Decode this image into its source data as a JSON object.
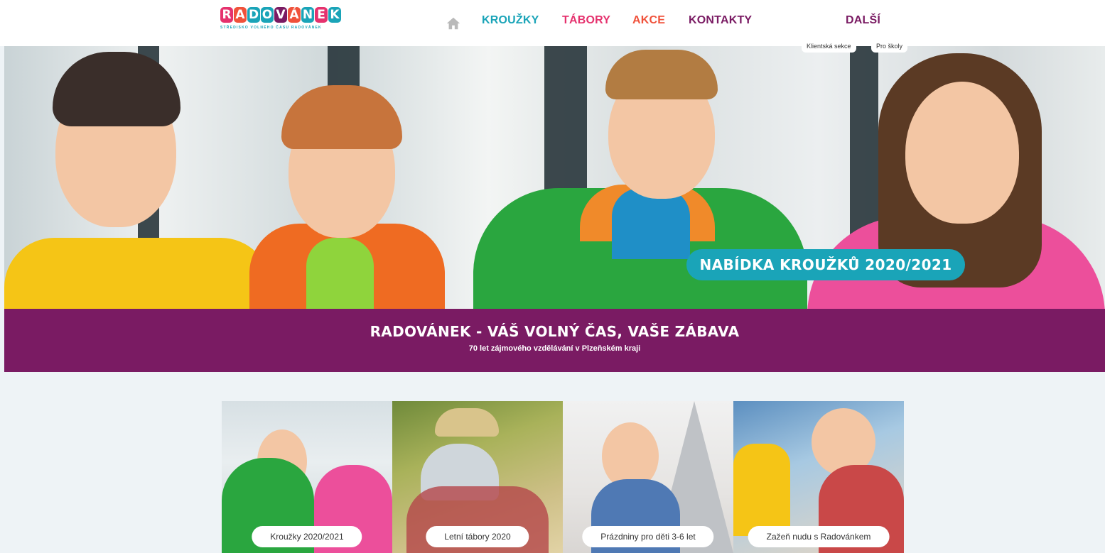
{
  "header": {
    "logo_text": "RADOVÁNEK",
    "logo_tagline": "STŘEDISKO VOLNÉHO ČASU RADOVÁNEK",
    "logo_colors": [
      "#e5326e",
      "#f0523b",
      "#1aa4b8",
      "#1aa4b8",
      "#7a1b63",
      "#f0523b",
      "#1aa4b8",
      "#e5326e",
      "#1aa4b8"
    ],
    "nav": {
      "home_icon": "home-icon",
      "krouzky": "KROUŽKY",
      "tabory": "TÁBORY",
      "akce": "AKCE",
      "kontakty": "KONTAKTY",
      "dalsi": "DALŠÍ"
    },
    "sub_links": {
      "klientska": "Klientská sekce",
      "skoly": "Pro školy"
    }
  },
  "hero": {
    "badge": "NABÍDKA KROUŽKŮ 2020/2021"
  },
  "banner": {
    "title": "RADOVÁNEK - VÁŠ VOLNÝ ČAS, VAŠE ZÁBAVA",
    "subtitle": "70 let zájmového vzdělávání v Plzeňském kraji"
  },
  "cards": [
    {
      "label": "Kroužky 2020/2021"
    },
    {
      "label": "Letní tábory 2020"
    },
    {
      "label": "Prázdniny pro děti 3-6 let"
    },
    {
      "label": "Zažeň nudu s Radovánkem"
    }
  ],
  "colors": {
    "teal": "#1aa4b8",
    "pink": "#e5326e",
    "orange": "#f0523b",
    "purple": "#7a1b63"
  }
}
